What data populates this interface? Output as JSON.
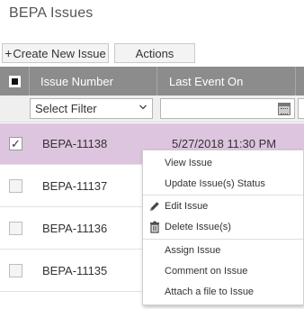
{
  "page": {
    "title": "BEPA Issues"
  },
  "toolbar": {
    "create_label": "Create New Issue",
    "create_icon": "plus-icon",
    "actions_label": "Actions"
  },
  "grid": {
    "columns": [
      "Issue Number",
      "Last Event On"
    ],
    "filter": {
      "issue_select_value": "Select Filter",
      "date_value": ""
    },
    "rows": [
      {
        "issue_number": "BEPA-11138",
        "last_event_on": "5/27/2018 11:30 PM",
        "selected": true
      },
      {
        "issue_number": "BEPA-11137",
        "last_event_on": "",
        "selected": false
      },
      {
        "issue_number": "BEPA-11136",
        "last_event_on": "",
        "selected": false
      },
      {
        "issue_number": "BEPA-11135",
        "last_event_on": "",
        "selected": false
      }
    ]
  },
  "context_menu": {
    "items": [
      {
        "label": "View Issue",
        "icon": null
      },
      {
        "label": "Update Issue(s) Status",
        "icon": null
      },
      {
        "label": "Edit Issue",
        "icon": "pencil-icon"
      },
      {
        "label": "Delete Issue(s)",
        "icon": "trash-icon"
      },
      {
        "label": "Assign Issue",
        "icon": null
      },
      {
        "label": "Comment on Issue",
        "icon": null
      },
      {
        "label": "Attach a file to Issue",
        "icon": null
      }
    ]
  },
  "colors": {
    "header_bg": "#8c8c8c",
    "selected_row": "#dec5df",
    "button_bg": "#f3f3f3"
  }
}
